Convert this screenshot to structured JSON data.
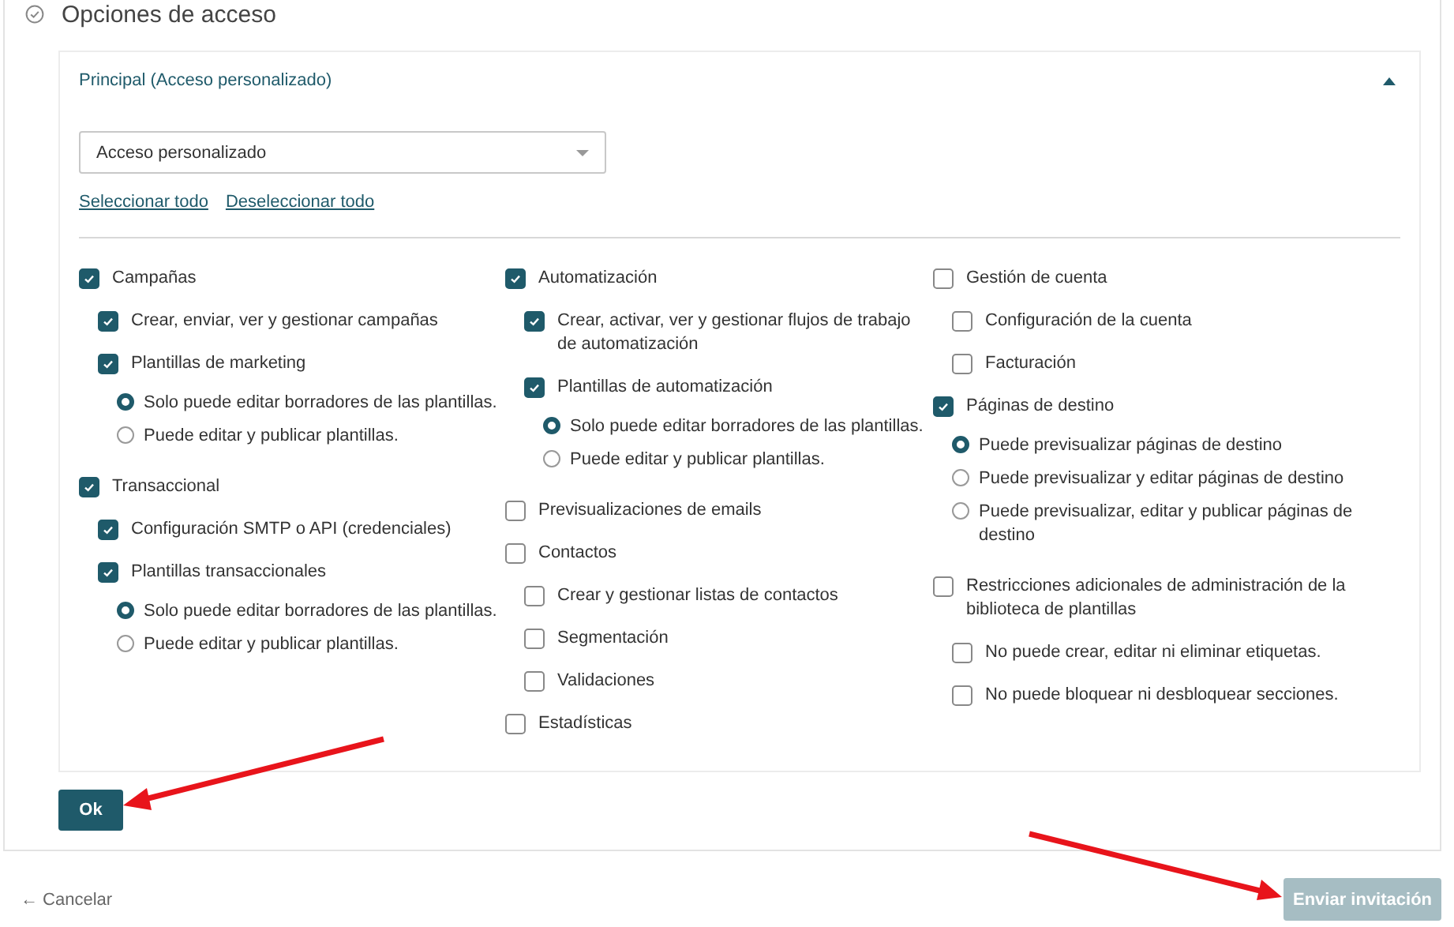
{
  "section": {
    "title": "Opciones de acceso"
  },
  "panel": {
    "title": "Principal (Acceso personalizado)",
    "expanded": true,
    "select": {
      "value": "Acceso personalizado"
    },
    "links": [
      "Seleccionar todo",
      "Deseleccionar todo"
    ],
    "columns": [
      [
        {
          "kind": "checkbox",
          "label": "Campañas",
          "checked": true,
          "children": [
            {
              "kind": "checkbox",
              "label": "Crear, enviar, ver y gestionar campañas",
              "checked": true
            },
            {
              "kind": "checkbox",
              "label": "Plantillas de marketing",
              "checked": true,
              "children": [
                {
                  "kind": "radio",
                  "label": "Solo puede editar borradores de las plantillas.",
                  "selected": true
                },
                {
                  "kind": "radio",
                  "label": "Puede editar y publicar plantillas.",
                  "selected": false
                }
              ]
            }
          ]
        },
        {
          "kind": "checkbox",
          "label": "Transaccional",
          "checked": true,
          "children": [
            {
              "kind": "checkbox",
              "label": "Configuración SMTP o API (credenciales)",
              "checked": true
            },
            {
              "kind": "checkbox",
              "label": "Plantillas transaccionales",
              "checked": true,
              "children": [
                {
                  "kind": "radio",
                  "label": "Solo puede editar borradores de las plantillas.",
                  "selected": true
                },
                {
                  "kind": "radio",
                  "label": "Puede editar y publicar plantillas.",
                  "selected": false
                }
              ]
            }
          ]
        }
      ],
      [
        {
          "kind": "checkbox",
          "label": "Automatización",
          "checked": true,
          "children": [
            {
              "kind": "checkbox",
              "label": "Crear, activar, ver y gestionar flujos de trabajo de automatización",
              "checked": true
            },
            {
              "kind": "checkbox",
              "label": "Plantillas de automatización",
              "checked": true,
              "children": [
                {
                  "kind": "radio",
                  "label": "Solo puede editar borradores de las plantillas.",
                  "selected": true
                },
                {
                  "kind": "radio",
                  "label": "Puede editar y publicar plantillas.",
                  "selected": false
                }
              ]
            }
          ]
        },
        {
          "kind": "checkbox",
          "label": "Previsualizaciones de emails",
          "checked": false
        },
        {
          "kind": "checkbox",
          "label": "Contactos",
          "checked": false,
          "children": [
            {
              "kind": "checkbox",
              "label": "Crear y gestionar listas de contactos",
              "checked": false
            },
            {
              "kind": "checkbox",
              "label": "Segmentación",
              "checked": false
            },
            {
              "kind": "checkbox",
              "label": "Validaciones",
              "checked": false
            }
          ]
        },
        {
          "kind": "checkbox",
          "label": "Estadísticas",
          "checked": false
        }
      ],
      [
        {
          "kind": "checkbox",
          "label": "Gestión de cuenta",
          "checked": false,
          "children": [
            {
              "kind": "checkbox",
              "label": "Configuración de la cuenta",
              "checked": false
            },
            {
              "kind": "checkbox",
              "label": "Facturación",
              "checked": false
            }
          ]
        },
        {
          "kind": "checkbox",
          "label": "Páginas de destino",
          "checked": true,
          "children": [
            {
              "kind": "radio",
              "label": "Puede previsualizar páginas de destino",
              "selected": true
            },
            {
              "kind": "radio",
              "label": "Puede previsualizar y editar páginas de destino",
              "selected": false
            },
            {
              "kind": "radio",
              "label": "Puede previsualizar, editar y publicar páginas de destino",
              "selected": false
            }
          ]
        },
        {
          "kind": "checkbox",
          "label": "Restricciones adicionales de administración de la biblioteca de plantillas",
          "checked": false,
          "children": [
            {
              "kind": "checkbox",
              "label": "No puede crear, editar ni eliminar etiquetas.",
              "checked": false
            },
            {
              "kind": "checkbox",
              "label": "No puede bloquear ni desbloquear secciones.",
              "checked": false
            }
          ]
        }
      ]
    ]
  },
  "ok_button": {
    "label": "Ok"
  },
  "footer": {
    "cancel": {
      "icon": "←",
      "label": "Cancelar"
    },
    "submit": {
      "label": "Enviar invitación",
      "disabled": true
    }
  }
}
